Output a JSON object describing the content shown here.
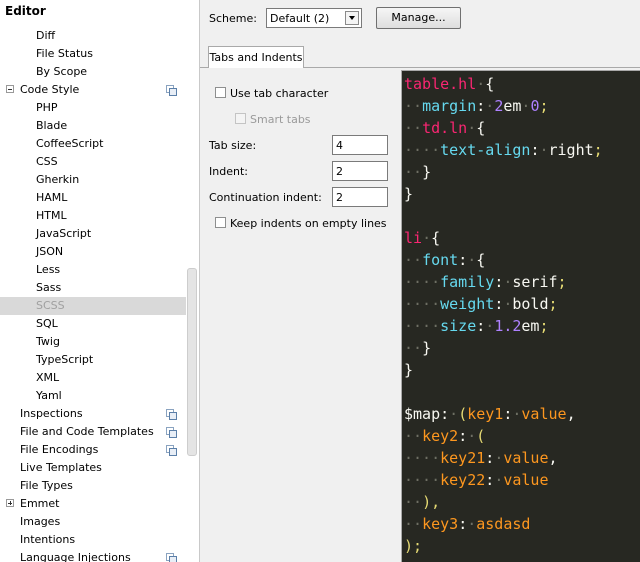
{
  "sidebar": {
    "title": "Editor",
    "items": [
      {
        "label": "Diff",
        "indent": 2
      },
      {
        "label": "File Status",
        "indent": 2
      },
      {
        "label": "By Scope",
        "indent": 2
      },
      {
        "label": "Code Style",
        "indent": 1,
        "expander": "minus",
        "project_icon": true
      },
      {
        "label": "PHP",
        "indent": 2
      },
      {
        "label": "Blade",
        "indent": 2
      },
      {
        "label": "CoffeeScript",
        "indent": 2
      },
      {
        "label": "CSS",
        "indent": 2
      },
      {
        "label": "Gherkin",
        "indent": 2
      },
      {
        "label": "HAML",
        "indent": 2
      },
      {
        "label": "HTML",
        "indent": 2
      },
      {
        "label": "JavaScript",
        "indent": 2
      },
      {
        "label": "JSON",
        "indent": 2
      },
      {
        "label": "Less",
        "indent": 2
      },
      {
        "label": "Sass",
        "indent": 2
      },
      {
        "label": "SCSS",
        "indent": 2,
        "selected": true
      },
      {
        "label": "SQL",
        "indent": 2
      },
      {
        "label": "Twig",
        "indent": 2
      },
      {
        "label": "TypeScript",
        "indent": 2
      },
      {
        "label": "XML",
        "indent": 2
      },
      {
        "label": "Yaml",
        "indent": 2
      },
      {
        "label": "Inspections",
        "indent": 1,
        "project_icon": true
      },
      {
        "label": "File and Code Templates",
        "indent": 1,
        "project_icon": true
      },
      {
        "label": "File Encodings",
        "indent": 1,
        "project_icon": true
      },
      {
        "label": "Live Templates",
        "indent": 1
      },
      {
        "label": "File Types",
        "indent": 1
      },
      {
        "label": "Emmet",
        "indent": 1,
        "expander": "plus"
      },
      {
        "label": "Images",
        "indent": 1
      },
      {
        "label": "Intentions",
        "indent": 1
      },
      {
        "label": "Language Injections",
        "indent": 1,
        "project_icon": true
      }
    ]
  },
  "scheme": {
    "label": "Scheme:",
    "value": "Default (2)",
    "manage_label": "Manage..."
  },
  "tabs": [
    {
      "label": "Tabs and Indents",
      "active": true
    }
  ],
  "options": {
    "use_tab_character": {
      "label": "Use tab character",
      "checked": false
    },
    "smart_tabs": {
      "label": "Smart tabs",
      "checked": false,
      "enabled": false
    },
    "tab_size": {
      "label": "Tab size:",
      "value": "4"
    },
    "indent": {
      "label": "Indent:",
      "value": "2"
    },
    "continuation_indent": {
      "label": "Continuation indent:",
      "value": "2"
    },
    "keep_indents": {
      "label": "Keep indents on empty lines",
      "checked": false
    }
  },
  "colors": {
    "editor_bg": "#272822",
    "selector": "#f92672",
    "property": "#66d9ef",
    "number": "#ae81ff",
    "punct": "#f8f8f2",
    "string": "#e6db74",
    "variable": "#f8f8f2",
    "map_key": "#fd971f",
    "whitespace": "#6e6f64"
  },
  "code_preview": {
    "lines": [
      [
        {
          "t": "table",
          "c": "selector"
        },
        {
          "t": ".hl",
          "c": "selector"
        },
        {
          "t": "·",
          "c": "whitespace"
        },
        {
          "t": "{",
          "c": "punct"
        }
      ],
      [
        {
          "t": "··",
          "c": "whitespace"
        },
        {
          "t": "margin",
          "c": "property"
        },
        {
          "t": ":",
          "c": "punct"
        },
        {
          "t": "·",
          "c": "whitespace"
        },
        {
          "t": "2",
          "c": "number"
        },
        {
          "t": "em",
          "c": "punct"
        },
        {
          "t": "·",
          "c": "whitespace"
        },
        {
          "t": "0",
          "c": "number"
        },
        {
          "t": ";",
          "c": "string"
        }
      ],
      [
        {
          "t": "··",
          "c": "whitespace"
        },
        {
          "t": "td",
          "c": "selector"
        },
        {
          "t": ".ln",
          "c": "selector"
        },
        {
          "t": "·",
          "c": "whitespace"
        },
        {
          "t": "{",
          "c": "punct"
        }
      ],
      [
        {
          "t": "····",
          "c": "whitespace"
        },
        {
          "t": "text-align",
          "c": "property"
        },
        {
          "t": ":",
          "c": "punct"
        },
        {
          "t": "·",
          "c": "whitespace"
        },
        {
          "t": "right",
          "c": "punct"
        },
        {
          "t": ";",
          "c": "string"
        }
      ],
      [
        {
          "t": "··",
          "c": "whitespace"
        },
        {
          "t": "}",
          "c": "punct"
        }
      ],
      [
        {
          "t": "}",
          "c": "punct"
        }
      ],
      [],
      [
        {
          "t": "li",
          "c": "selector"
        },
        {
          "t": "·",
          "c": "whitespace"
        },
        {
          "t": "{",
          "c": "punct"
        }
      ],
      [
        {
          "t": "··",
          "c": "whitespace"
        },
        {
          "t": "font",
          "c": "property"
        },
        {
          "t": ":",
          "c": "punct"
        },
        {
          "t": "·",
          "c": "whitespace"
        },
        {
          "t": "{",
          "c": "punct"
        }
      ],
      [
        {
          "t": "····",
          "c": "whitespace"
        },
        {
          "t": "family",
          "c": "property"
        },
        {
          "t": ":",
          "c": "punct"
        },
        {
          "t": "·",
          "c": "whitespace"
        },
        {
          "t": "serif",
          "c": "punct"
        },
        {
          "t": ";",
          "c": "string"
        }
      ],
      [
        {
          "t": "····",
          "c": "whitespace"
        },
        {
          "t": "weight",
          "c": "property"
        },
        {
          "t": ":",
          "c": "punct"
        },
        {
          "t": "·",
          "c": "whitespace"
        },
        {
          "t": "bold",
          "c": "punct"
        },
        {
          "t": ";",
          "c": "string"
        }
      ],
      [
        {
          "t": "····",
          "c": "whitespace"
        },
        {
          "t": "size",
          "c": "property"
        },
        {
          "t": ":",
          "c": "punct"
        },
        {
          "t": "·",
          "c": "whitespace"
        },
        {
          "t": "1.2",
          "c": "number"
        },
        {
          "t": "em",
          "c": "punct"
        },
        {
          "t": ";",
          "c": "string"
        }
      ],
      [
        {
          "t": "··",
          "c": "whitespace"
        },
        {
          "t": "}",
          "c": "punct"
        }
      ],
      [
        {
          "t": "}",
          "c": "punct"
        }
      ],
      [],
      [
        {
          "t": "$map",
          "c": "variable"
        },
        {
          "t": ":",
          "c": "punct"
        },
        {
          "t": "·",
          "c": "whitespace"
        },
        {
          "t": "(",
          "c": "string"
        },
        {
          "t": "key1",
          "c": "map_key"
        },
        {
          "t": ":",
          "c": "punct"
        },
        {
          "t": "·",
          "c": "whitespace"
        },
        {
          "t": "value",
          "c": "map_key"
        },
        {
          "t": ",",
          "c": "punct"
        }
      ],
      [
        {
          "t": "··",
          "c": "whitespace"
        },
        {
          "t": "key2",
          "c": "map_key"
        },
        {
          "t": ":",
          "c": "punct"
        },
        {
          "t": "·",
          "c": "whitespace"
        },
        {
          "t": "(",
          "c": "string"
        }
      ],
      [
        {
          "t": "····",
          "c": "whitespace"
        },
        {
          "t": "key21",
          "c": "map_key"
        },
        {
          "t": ":",
          "c": "punct"
        },
        {
          "t": "·",
          "c": "whitespace"
        },
        {
          "t": "value",
          "c": "map_key"
        },
        {
          "t": ",",
          "c": "punct"
        }
      ],
      [
        {
          "t": "····",
          "c": "whitespace"
        },
        {
          "t": "key22",
          "c": "map_key"
        },
        {
          "t": ":",
          "c": "punct"
        },
        {
          "t": "·",
          "c": "whitespace"
        },
        {
          "t": "value",
          "c": "map_key"
        }
      ],
      [
        {
          "t": "··",
          "c": "whitespace"
        },
        {
          "t": "),",
          "c": "string"
        }
      ],
      [
        {
          "t": "··",
          "c": "whitespace"
        },
        {
          "t": "key3",
          "c": "map_key"
        },
        {
          "t": ":",
          "c": "punct"
        },
        {
          "t": "·",
          "c": "whitespace"
        },
        {
          "t": "asdasd",
          "c": "map_key"
        }
      ],
      [
        {
          "t": ");",
          "c": "string"
        }
      ]
    ]
  }
}
